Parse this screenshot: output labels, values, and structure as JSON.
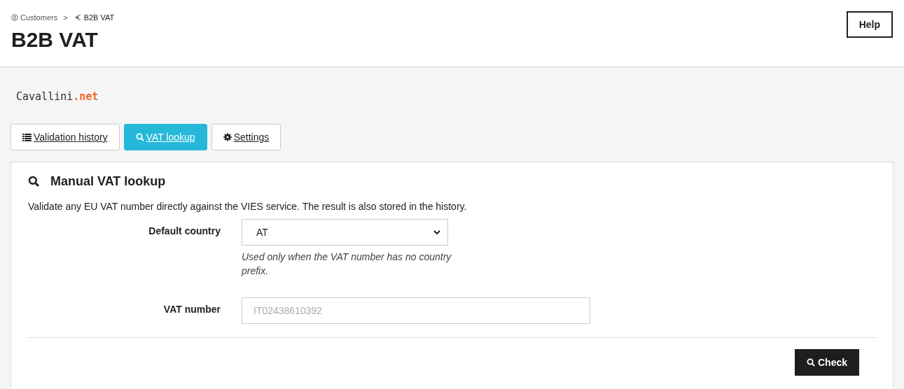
{
  "breadcrumb": [
    {
      "kind": "customers",
      "label": "Customers"
    },
    {
      "kind": "vat",
      "label": "B2B VAT"
    }
  ],
  "breadcrumb_separator": ">",
  "page_title": "B2B VAT",
  "help_button": "Help",
  "logo": {
    "name": "Cavallini",
    "suffix": ".net"
  },
  "tabs": [
    {
      "kind": "list",
      "label": "Validation history",
      "selected": false
    },
    {
      "kind": "search",
      "label": "VAT lookup",
      "selected": true
    },
    {
      "kind": "gear",
      "label": "Settings",
      "selected": false
    }
  ],
  "panel": {
    "title": "Manual VAT lookup",
    "description": "Validate any EU VAT number directly against the VIES service. The result is also stored in the history.",
    "fields": [
      {
        "kind": "select",
        "label": "Default country",
        "value": "AT",
        "help": "Used only when the VAT number has no country prefix."
      },
      {
        "kind": "text",
        "label": "VAT number",
        "placeholder": "IT02438610392"
      }
    ],
    "submit": "Check"
  }
}
